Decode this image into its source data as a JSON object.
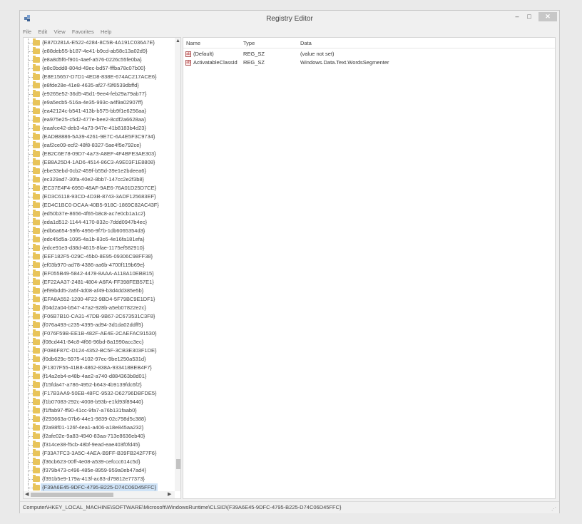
{
  "window": {
    "title": "Registry Editor",
    "controls": {
      "minimize": "–",
      "maximize": "□",
      "close": "✕"
    }
  },
  "menu": [
    "File",
    "Edit",
    "View",
    "Favorites",
    "Help"
  ],
  "tree": {
    "items": [
      "{E87D281A-E522-4284-8C5B-4A191C036A7E}",
      "{e88deb55-b187-4e41-b9cd-ab58c13a02d9}",
      "{e8a8d5f6-f901-4aef-a576-0226c55fe0ba}",
      "{e8c0bdd8-804d-49ec-bd57-fffba78c07b00}",
      "{E8E15657-D7D1-4ED8-838E-674AC217ACE6}",
      "{e8fde28e-41e8-4635-af27-f3f6539dbffd}",
      "{e9265e52-36d5-45d1-9ee4-feb29a79ab77}",
      "{e9a5ecb5-516a-4e35-993c-a4f9a02907ff}",
      "{ea42124c-b541-413b-b575-bb9f1e6256aa}",
      "{ea975e25-c5d2-477e-bee2-8cdf2a6628aa}",
      "{eaafce42-deb3-4a73-947e-41b8183b4d23}",
      "{EADB8886-5A39-4261-9E7C-6A4E5F3C9734}",
      "{eaf2ce09-ecf2-48f8-8327-5ae4f5e792ce}",
      "{EB2C6E78-09D7-4a73-A8EF-4F4BFE3AE303}",
      "{EB8A25D4-1AD6-4514-86C3-A9E03F1E8808}",
      "{ebe33ebd-0cb2-459f-b55d-39e1e2bdeea6}",
      "{ec329ad7-30fa-40e2-8bb7-147cc2e2f3b8}",
      "{EC37E4F4-6950-48AF-9AE6-76A01D25D7CE}",
      "{ED3C6118-93CD-4D3B-8743-3ADF125683EF}",
      "{ED4C1BC0-DCAA-40B5-918C-1869C82AC43F}",
      "{ed50b37e-8656-4f65-b8c8-ac7e0cb1a1c2}",
      "{eda1d512-1144-4170-832c-7ddd0947b4ec}",
      "{edb6a654-59f6-4956-9f7b-1db6065354d3}",
      "{edc45d5a-1095-4a1b-83c6-4e16fa181efa}",
      "{edce91e3-d38d-4615-8fae-1175ef582910}",
      "{EEF182F5-029C-45b0-8E95-09306C98FF38}",
      "{ef03b970-ad78-4386-aa6b-4700f119b69e}",
      "{EF055B49-5842-4478-8AAA-A118A10EBB15}",
      "{EF22AA37-2481-4804-A6FA-FF398FEB57E1}",
      "{ef99bdd5-2a5f-4d08-af49-b3d4dd385e5b}",
      "{EFA8A552-1200-4F22-9BD4-5F79BC9E1DF1}",
      "{f04d2a04-b547-47a2-928b-a5eb07822e2c}",
      "{F06B7B10-CA31-47DB-9B67-2C673531C3F8}",
      "{f076a493-c235-4395-ad94-3d1da02ddff5}",
      "{F076F59B-EE1B-482F-AE4E-2CAEFAC91530}",
      "{f08cd441-84c8-4f66-96bd-8a1990acc3ec}",
      "{F0B6F87C-D124-4352-BC5F-3CB3E303F1DE}",
      "{f0db629c-5975-4102-97ec-9be1250a531d}",
      "{F1307F55-41B8-4862-838A-933418BEB4F7}",
      "{f14a2eb4-e48b-4ae2-a740-d884363b8d01}",
      "{f15fda47-a786-4952-b643-4b9139fdc6f2}",
      "{F17B3AA9-50EB-48FC-9532-D62796DBFDE5}",
      "{f1b07083-292c-4008-b93b-e1fd93f89440}",
      "{f1ffab97-ff90-41cc-9fa7-a76b131faab0}",
      "{f293663a-07b6-44e1-9839-02c798d5c388}",
      "{f2a98f01-126f-4ea1-a406-a18e845aa232}",
      "{f2afe02e-9a83-4940-83aa-713e8636eb40}",
      "{f314ce38-f5cb-48bf-9ead-eae403f0fd45}",
      "{F33A7FC3-3A5C-4AEA-B9FF-B39FB242F7F6}",
      "{f36cb623-00ff-4e08-a539-cefccc614c5d}",
      "{f379b473-c496-485e-8959-959a0eb47ad4}",
      "{f391b5e9-179a-413f-ac83-d79812e77373}",
      "{F39A6E45-9DFC-4795-B225-D74C06D45FFC}"
    ],
    "selected_index": 52
  },
  "values": {
    "headers": {
      "name": "Name",
      "type": "Type",
      "data": "Data"
    },
    "rows": [
      {
        "name": "(Default)",
        "type": "REG_SZ",
        "data": "(value not set)",
        "icon": "ab"
      },
      {
        "name": "ActivatableClassId",
        "type": "REG_SZ",
        "data": "Windows.Data.Text.WordsSegmenter",
        "icon": "ab"
      }
    ]
  },
  "status": {
    "path": "Computer\\HKEY_LOCAL_MACHINE\\SOFTWARE\\Microsoft\\WindowsRuntime\\CLSID\\{F39A6E45-9DFC-4795-B225-D74C06D45FFC}"
  }
}
